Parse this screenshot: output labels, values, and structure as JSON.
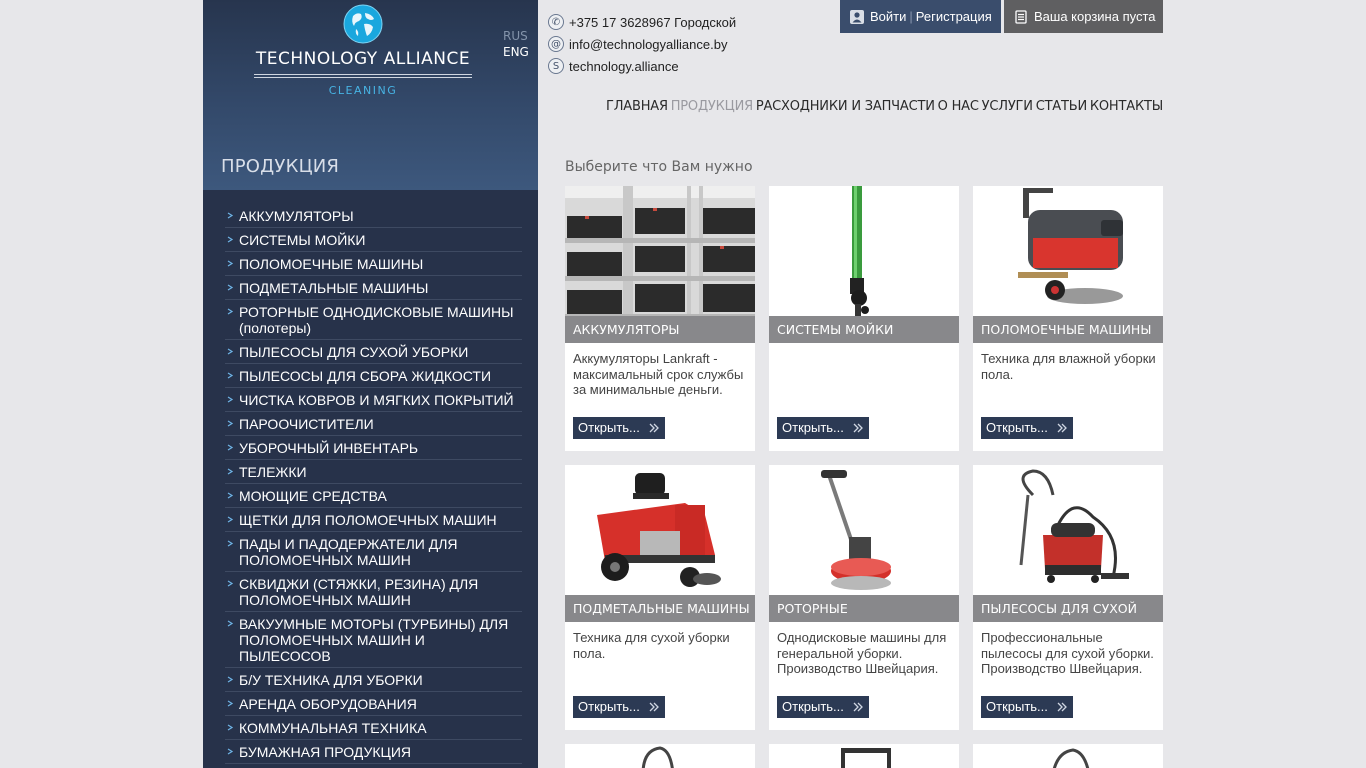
{
  "brand": {
    "logo_title": "TECHNOLOGY ALLIANCE",
    "logo_sub": "CLEANING",
    "lang_ru": "RUS",
    "lang_en": "ENG"
  },
  "contacts": {
    "phone": "+375 17 3628967 Городской",
    "email": "info@technologyalliance.by",
    "skype": "technology.alliance"
  },
  "account": {
    "login": "Войти",
    "register": "Регистрация",
    "cart": "Ваша корзина пуста"
  },
  "nav": [
    {
      "label": "ГЛАВНАЯ",
      "active": false
    },
    {
      "label": "ПРОДУКЦИЯ",
      "active": true
    },
    {
      "label": "РАСХОДНИКИ И ЗАПЧАСТИ",
      "active": false
    },
    {
      "label": "О НАС",
      "active": false
    },
    {
      "label": "УСЛУГИ",
      "active": false
    },
    {
      "label": "СТАТЬИ",
      "active": false
    },
    {
      "label": "КОНТАКТЫ",
      "active": false
    }
  ],
  "sidebar": {
    "title": "ПРОДУКЦИЯ",
    "items": [
      "АККУМУЛЯТОРЫ",
      "СИСТЕМЫ МОЙКИ",
      "ПОЛОМОЕЧНЫЕ МАШИНЫ",
      "ПОДМЕТАЛЬНЫЕ МАШИНЫ",
      "РОТОРНЫЕ ОДНОДИСКОВЫЕ МАШИНЫ (полотеры)",
      "ПЫЛЕСОСЫ ДЛЯ СУХОЙ УБОРКИ",
      "ПЫЛЕСОСЫ ДЛЯ СБОРА ЖИДКОСТИ",
      "ЧИСТКА КОВРОВ И МЯГКИХ ПОКРЫТИЙ",
      "ПАРООЧИСТИТЕЛИ",
      "УБОРОЧНЫЙ ИНВЕНТАРЬ",
      "ТЕЛЕЖКИ",
      "МОЮЩИЕ СРЕДСТВА",
      "ЩЕТКИ ДЛЯ ПОЛОМОЕЧНЫХ МАШИН",
      "ПАДЫ И ПАДОДЕРЖАТЕЛИ ДЛЯ ПОЛОМОЕЧНЫХ МАШИН",
      "СКВИДЖИ (СТЯЖКИ, РЕЗИНА) ДЛЯ ПОЛОМОЕЧНЫХ МАШИН",
      "ВАКУУМНЫЕ МОТОРЫ (ТУРБИНЫ) ДЛЯ ПОЛОМОЕЧНЫХ МАШИН И ПЫЛЕСОСОВ",
      "Б/У ТЕХНИКА ДЛЯ УБОРКИ",
      "АРЕНДА ОБОРУДОВАНИЯ",
      "КОММУНАЛЬНАЯ ТЕХНИКА",
      "БУМАЖНАЯ ПРОДУКЦИЯ"
    ]
  },
  "main": {
    "subtitle": "Выберите что Вам нужно",
    "open_label": "Открыть...",
    "products": [
      {
        "caption": "АККУМУЛЯТОРЫ",
        "desc": "Аккумуляторы Lankraft - максимальный срок службы за минимальные деньги.",
        "image": "batteries-shelf"
      },
      {
        "caption": "СИСТЕМЫ МОЙКИ",
        "desc": "",
        "image": "washing-system"
      },
      {
        "caption": "ПОЛОМОЕЧНЫЕ МАШИНЫ",
        "desc": "Техника для влажной уборки пола.",
        "image": "scrubber-machine"
      },
      {
        "caption": "ПОДМЕТАЛЬНЫЕ МАШИНЫ",
        "desc": "Техника для сухой уборки пола.",
        "image": "sweeper-machine"
      },
      {
        "caption": "РОТОРНЫЕ",
        "desc": "Однодисковые машины для генеральной уборки. Производство Швейцария.",
        "image": "rotary-machine"
      },
      {
        "caption": "ПЫЛЕСОСЫ ДЛЯ СУХОЙ",
        "desc": "Профессиональные пылесосы для сухой уборки. Производство Швейцария.",
        "image": "dry-vacuum"
      }
    ]
  },
  "colors": {
    "sidebar_bg": "#27324a",
    "header_bg": "#3a4d6c",
    "caption_bg": "#88888b",
    "open_button_bg": "#2c3a54",
    "accent_blue": "#47b3e3"
  }
}
